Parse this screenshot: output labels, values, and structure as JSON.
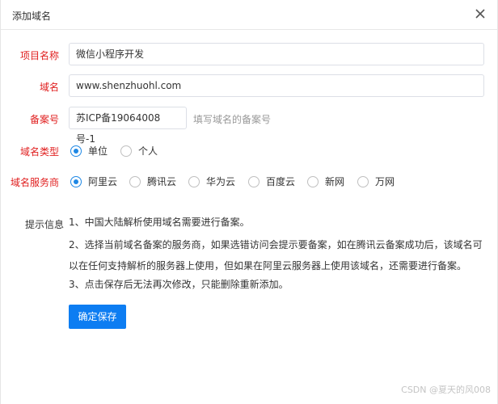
{
  "dialog": {
    "title": "添加域名"
  },
  "form": {
    "project_name": {
      "label": "项目名称",
      "value": "微信小程序开发"
    },
    "domain": {
      "label": "域名",
      "value": "www.shenzhuohl.com"
    },
    "icp": {
      "label": "备案号",
      "value": "苏ICP备19064008号-1",
      "hint": "填写域名的备案号"
    },
    "domain_type": {
      "label": "域名类型",
      "options": [
        "单位",
        "个人"
      ],
      "selected": "单位"
    },
    "provider": {
      "label": "域名服务商",
      "options": [
        "阿里云",
        "腾讯云",
        "华为云",
        "百度云",
        "新网",
        "万网"
      ],
      "selected": "阿里云"
    }
  },
  "tips": {
    "label": "提示信息",
    "lines": [
      "1、中国大陆解析使用域名需要进行备案。",
      "2、选择当前域名备案的服务商，如果选错访问会提示要备案，如在腾讯云备案成功后，该域名可以在任何支持解析的服务器上使用，但如果在阿里云服务器上使用该域名，还需要进行备案。",
      "3、点击保存后无法再次修改，只能删除重新添加。"
    ]
  },
  "actions": {
    "confirm_label": "确定保存"
  },
  "watermark": "CSDN @夏天的风008",
  "colors": {
    "accent": "#0d7df2",
    "required_label": "#e02020"
  }
}
